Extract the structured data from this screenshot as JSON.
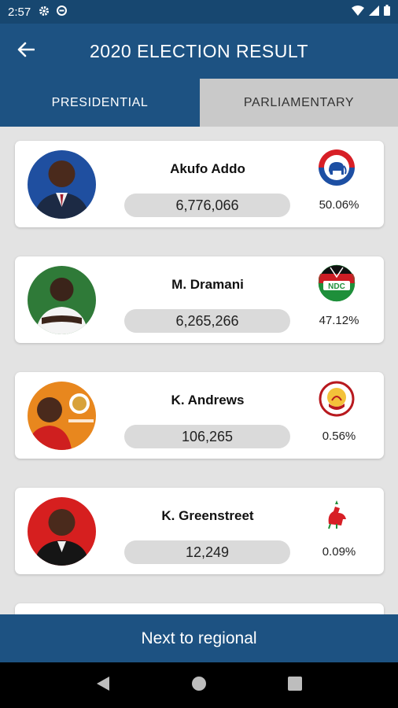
{
  "status_bar": {
    "time": "2:57",
    "icons": [
      "settings-icon",
      "data-saver-icon",
      "wifi-icon",
      "signal-icon",
      "battery-icon"
    ]
  },
  "app_bar": {
    "title": "2020 ELECTION RESULT",
    "back_icon": "arrow-back-icon"
  },
  "tabs": [
    {
      "label": "PRESIDENTIAL",
      "active": true
    },
    {
      "label": "PARLIAMENTARY",
      "active": false
    }
  ],
  "candidates": [
    {
      "name": "Akufo Addo",
      "votes": "6,776,066",
      "percent": "50.06%",
      "party_logo": "npp-elephant-logo",
      "avatar_bg": "#1f4fa0"
    },
    {
      "name": "M. Dramani",
      "votes": "6,265,266",
      "percent": "47.12%",
      "party_logo": "ndc-logo",
      "logo_text": "NDC",
      "avatar_bg": "#2f7a38"
    },
    {
      "name": "K. Andrews",
      "votes": "106,265",
      "percent": "0.56%",
      "party_logo": "gum-logo",
      "avatar_bg": "#e8871e"
    },
    {
      "name": "K. Greenstreet",
      "votes": "12,249",
      "percent": "0.09%",
      "party_logo": "cpp-cockerel-logo",
      "avatar_bg": "#d61f1f"
    }
  ],
  "bottom_button": {
    "label": "Next to regional"
  },
  "colors": {
    "primary": "#1d5282",
    "status_bar": "#174770",
    "inactive_tab": "#c9c9c9",
    "background": "#e3e3e3",
    "pill": "#dadada"
  }
}
